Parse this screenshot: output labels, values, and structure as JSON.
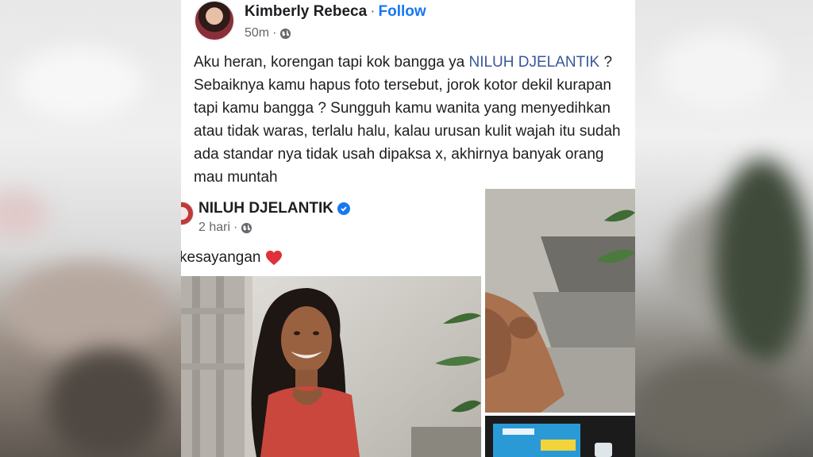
{
  "post": {
    "author": "Kimberly Rebeca",
    "separator": "·",
    "follow_label": "Follow",
    "time": "50m",
    "meta_dot": "·",
    "text_before_mention": "Aku heran, korengan tapi kok bangga ya ",
    "mention": "NILUH DJELANTIK",
    "text_after_mention": " ? Sebaiknya kamu hapus foto tersebut, jorok kotor dekil kurapan tapi kamu bangga ? Sungguh kamu wanita yang menyedihkan atau tidak waras, terlalu halu, kalau urusan kulit wajah itu sudah ada standar nya tidak usah dipaksa x, akhirnya banyak orang mau muntah"
  },
  "embed": {
    "name": "NILUH DJELANTIK",
    "time": "2 hari",
    "meta_dot": "·",
    "caption": "kesayangan"
  },
  "colors": {
    "link": "#1877f2",
    "mention": "#385898",
    "text": "#1c1e21",
    "muted": "#65676b"
  }
}
